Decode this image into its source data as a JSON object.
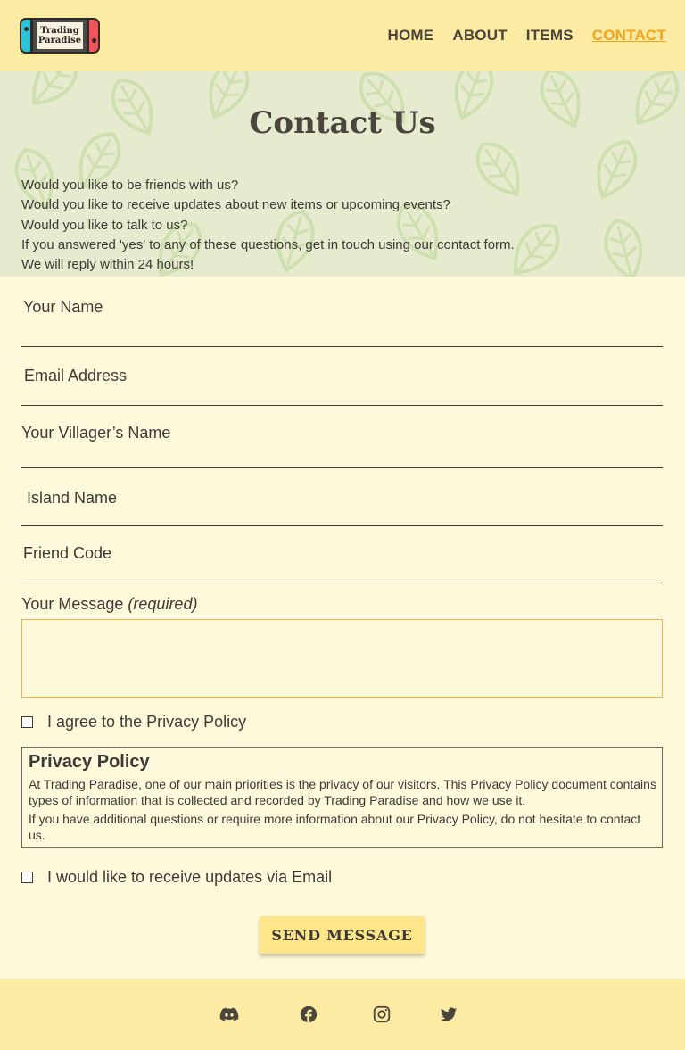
{
  "logo": {
    "line1": "Trading",
    "line2": "Paradise"
  },
  "nav": {
    "home": "HOME",
    "about": "ABOUT",
    "items": "ITEMS",
    "contact": "CONTACT"
  },
  "hero": {
    "title": "Contact Us",
    "lines": [
      "Would you like to be friends with us?",
      "Would you like to receive updates about new items or upcoming events?",
      "Would you like to talk to us?",
      "If you answered 'yes' to any of these questions, get in touch using our contact form.",
      "We will reply within 24 hours!"
    ]
  },
  "form": {
    "name_label": "Your Name",
    "email_label": "Email Address",
    "villager_label": "Your Villager’s Name",
    "island_label": "Island Name",
    "friend_code_label": "Friend Code",
    "message_label": "Your Message ",
    "message_required": "(required)",
    "agree_label": "I agree to the Privacy Policy",
    "updates_label": "I would like to receive updates via Email",
    "submit_label": "SEND MESSAGE"
  },
  "privacy": {
    "title": "Privacy Policy",
    "p1": "At Trading Paradise, one of our main priorities is the privacy of our visitors. This Privacy Policy document contains types of information that is collected and recorded by Trading Paradise and how we use it.",
    "p2": "If you have additional questions or require more information about our Privacy Policy, do not hesitate to contact us."
  },
  "footer": {
    "icons": [
      "discord-icon",
      "facebook-icon",
      "instagram-icon",
      "twitter-icon"
    ]
  },
  "colors": {
    "header_bg": "#fdeba3",
    "page_bg": "#fff9dc",
    "hero_bg": "#e6ebcf",
    "leaf": "#cfe0b0",
    "active_nav": "#f5a31a",
    "button_bg": "#fde68a"
  }
}
